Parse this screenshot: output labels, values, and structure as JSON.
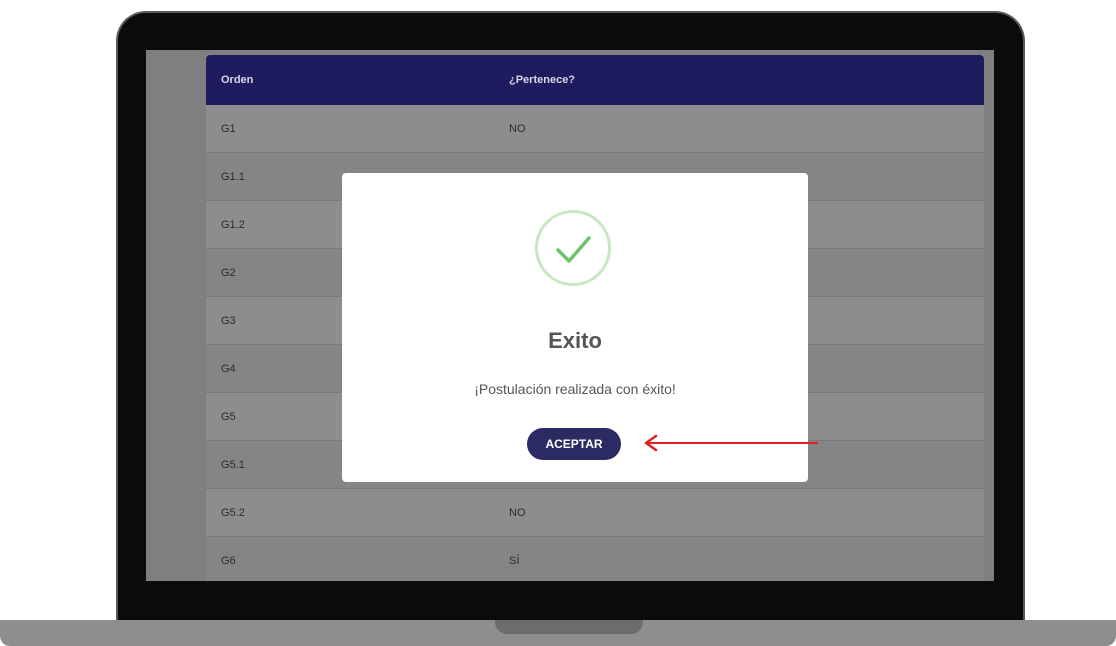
{
  "table": {
    "headers": [
      "Orden",
      "¿Pertenece?"
    ],
    "rows": [
      {
        "orden": "G1",
        "pertenece": "NO"
      },
      {
        "orden": "G1.1",
        "pertenece": ""
      },
      {
        "orden": "G1.2",
        "pertenece": ""
      },
      {
        "orden": "G2",
        "pertenece": ""
      },
      {
        "orden": "G3",
        "pertenece": ""
      },
      {
        "orden": "G4",
        "pertenece": ""
      },
      {
        "orden": "G5",
        "pertenece": ""
      },
      {
        "orden": "G5.1",
        "pertenece": ""
      },
      {
        "orden": "G5.2",
        "pertenece": "NO"
      },
      {
        "orden": "G6",
        "pertenece": "SÍ"
      }
    ]
  },
  "modal": {
    "icon": "check-icon",
    "title": "Exito",
    "message": "¡Postulación realizada con éxito!",
    "button_label": "ACEPTAR"
  },
  "colors": {
    "header_bg": "#1e1c5e",
    "button_bg": "#2b2a63",
    "check_green": "#6cc36a",
    "arrow_red": "#e02020"
  }
}
